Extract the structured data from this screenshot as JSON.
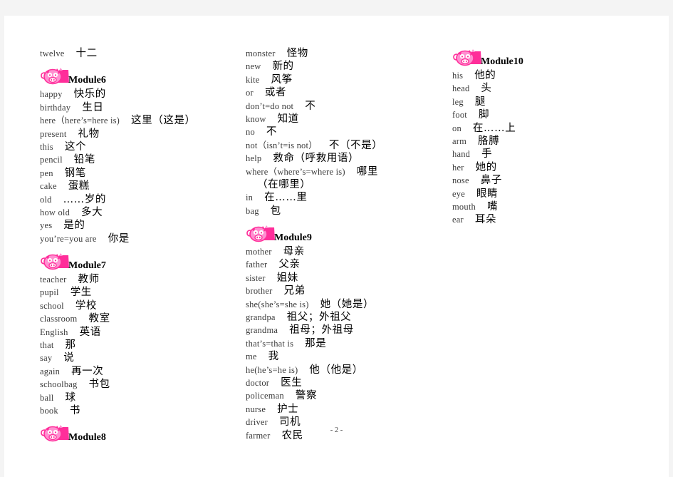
{
  "document": {
    "page_number_label": "- 2 -",
    "mascot_icon": "pig-mascot-icon",
    "accent_color": "#ff2e9a",
    "accent_color_light": "#ff8fd0",
    "text_color": "#3b3b3b"
  },
  "columns": [
    {
      "id": "column-1",
      "blocks": [
        {
          "type": "entries",
          "entries": [
            {
              "en": "twelve",
              "zh": "十二"
            }
          ]
        },
        {
          "type": "gap"
        },
        {
          "type": "module",
          "label": "Module6",
          "icon": "pig-mascot-icon"
        },
        {
          "type": "entries",
          "entries": [
            {
              "en": "happy",
              "zh": "快乐的"
            },
            {
              "en": "birthday",
              "zh": "生日"
            },
            {
              "en": "here（here’s=here is)",
              "zh": "这里（这是）"
            },
            {
              "en": "present",
              "zh": "礼物"
            },
            {
              "en": "this",
              "zh": "这个"
            },
            {
              "en": "pencil",
              "zh": "铅笔"
            },
            {
              "en": "pen",
              "zh": "钢笔"
            },
            {
              "en": "cake",
              "zh": "蛋糕"
            },
            {
              "en": "old",
              "zh": "……岁的"
            },
            {
              "en": "how old",
              "zh": "多大"
            },
            {
              "en": "yes",
              "zh": "是的"
            },
            {
              "en": "you’re=you are",
              "zh": "你是"
            }
          ]
        },
        {
          "type": "gap"
        },
        {
          "type": "module",
          "label": "Module7",
          "icon": "pig-mascot-icon"
        },
        {
          "type": "entries",
          "entries": [
            {
              "en": "teacher",
              "zh": "教师"
            },
            {
              "en": "pupil",
              "zh": "学生"
            },
            {
              "en": "school",
              "zh": "学校"
            },
            {
              "en": "classroom",
              "zh": "教室"
            },
            {
              "en": "English",
              "zh": "英语"
            },
            {
              "en": "that",
              "zh": "那"
            },
            {
              "en": "say",
              "zh": "说"
            },
            {
              "en": "again",
              "zh": "再一次"
            },
            {
              "en": "schoolbag",
              "zh": "书包"
            },
            {
              "en": "ball",
              "zh": "球"
            },
            {
              "en": "book",
              "zh": "书"
            }
          ]
        },
        {
          "type": "gap"
        },
        {
          "type": "module",
          "label": "Module8",
          "icon": "pig-mascot-icon"
        }
      ]
    },
    {
      "id": "column-2",
      "blocks": [
        {
          "type": "entries",
          "entries": [
            {
              "en": "monster",
              "zh": "怪物"
            },
            {
              "en": "new",
              "zh": "新的"
            },
            {
              "en": "kite",
              "zh": "风筝"
            },
            {
              "en": "or",
              "zh": "或者"
            },
            {
              "en": "don’t=do not",
              "zh": "不"
            },
            {
              "en": "know",
              "zh": "知道"
            },
            {
              "en": "no",
              "zh": "不"
            },
            {
              "en": "not（isn’t=is not）",
              "zh": "不（不是）"
            },
            {
              "en": "help",
              "zh": "救命（呼救用语）"
            },
            {
              "en": "where（where’s=where is)",
              "zh": "哪里"
            },
            {
              "en": "",
              "zh": "（在哪里）"
            },
            {
              "en": "in",
              "zh": "在……里"
            },
            {
              "en": "bag",
              "zh": "包"
            }
          ]
        },
        {
          "type": "gap"
        },
        {
          "type": "module",
          "label": "Module9",
          "icon": "pig-mascot-icon"
        },
        {
          "type": "entries",
          "entries": [
            {
              "en": "mother",
              "zh": "母亲"
            },
            {
              "en": "father",
              "zh": "父亲"
            },
            {
              "en": "sister",
              "zh": "姐妹"
            },
            {
              "en": "brother",
              "zh": "兄弟"
            },
            {
              "en": "she(she’s=she is)",
              "zh": "她（她是）"
            },
            {
              "en": "grandpa",
              "zh": "祖父；外祖父"
            },
            {
              "en": "grandma",
              "zh": "祖母；外祖母"
            },
            {
              "en": "that’s=that is",
              "zh": "那是"
            },
            {
              "en": "me",
              "zh": "我"
            },
            {
              "en": "he(he’s=he is)",
              "zh": "他（他是）"
            },
            {
              "en": "doctor",
              "zh": "医生"
            },
            {
              "en": "policeman",
              "zh": "警察"
            },
            {
              "en": "nurse",
              "zh": "护士"
            },
            {
              "en": "driver",
              "zh": "司机"
            },
            {
              "en": "farmer",
              "zh": "农民"
            }
          ]
        }
      ]
    },
    {
      "id": "column-3",
      "blocks": [
        {
          "type": "module",
          "label": "Module10",
          "icon": "pig-mascot-icon"
        },
        {
          "type": "entries",
          "entries": [
            {
              "en": "his",
              "zh": "他的"
            },
            {
              "en": "head",
              "zh": "头"
            },
            {
              "en": "leg",
              "zh": "腿"
            },
            {
              "en": "foot",
              "zh": "脚"
            },
            {
              "en": "on",
              "zh": "在……上"
            },
            {
              "en": "arm",
              "zh": "胳膊"
            },
            {
              "en": "hand",
              "zh": "手"
            },
            {
              "en": "her",
              "zh": "她的"
            },
            {
              "en": "nose",
              "zh": "鼻子"
            },
            {
              "en": "eye",
              "zh": "眼睛"
            },
            {
              "en": "mouth",
              "zh": "嘴"
            },
            {
              "en": "ear",
              "zh": "耳朵"
            }
          ]
        }
      ]
    }
  ]
}
